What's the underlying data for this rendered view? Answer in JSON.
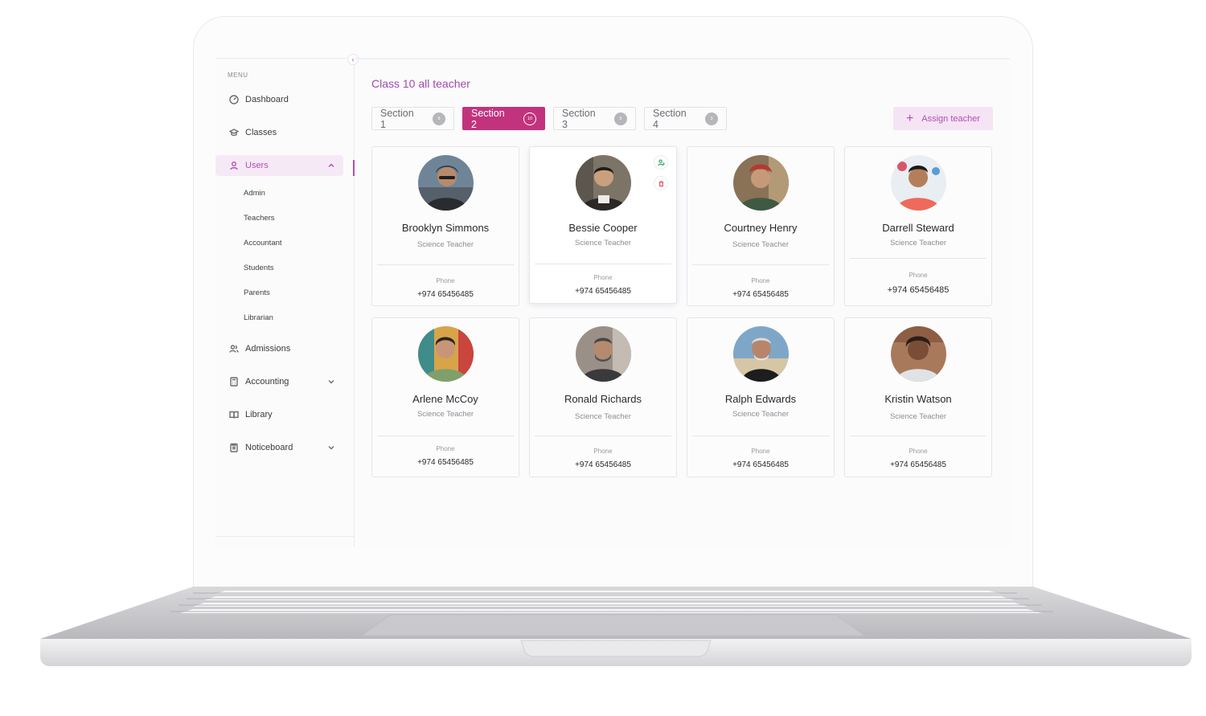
{
  "sidebar": {
    "menu_label": "MENU",
    "items": [
      {
        "label": "Dashboard",
        "icon": "dashboard-icon"
      },
      {
        "label": "Classes",
        "icon": "graduation-cap-icon"
      },
      {
        "label": "Users",
        "icon": "user-icon",
        "expanded": true
      },
      {
        "label": "Admissions",
        "icon": "users-icon"
      },
      {
        "label": "Accounting",
        "icon": "calculator-icon"
      },
      {
        "label": "Library",
        "icon": "book-icon"
      },
      {
        "label": "Noticeboard",
        "icon": "clipboard-icon"
      }
    ],
    "sub_items": [
      "Admin",
      "Teachers",
      "Accountant",
      "Students",
      "Parents",
      "Librarian"
    ]
  },
  "main": {
    "title": "Class 10 all teacher",
    "tabs": [
      {
        "label": "Section 1",
        "count": "8"
      },
      {
        "label": "Section 2",
        "count": "10",
        "active": true
      },
      {
        "label": "Section 3",
        "count": "5"
      },
      {
        "label": "Section 4",
        "count": "3"
      }
    ],
    "assign_button": "Assign teacher",
    "phone_label": "Phone",
    "teachers": [
      {
        "name": "Brooklyn Simmons",
        "role": "Science Teacher",
        "phone": "+974 65456485"
      },
      {
        "name": "Bessie Cooper",
        "role": "Science Teacher",
        "phone": "+974 65456485"
      },
      {
        "name": "Courtney Henry",
        "role": "Science Teacher",
        "phone": "+974 65456485"
      },
      {
        "name": "Darrell Steward",
        "role": "Science Teacher",
        "phone": "+974 65456485"
      },
      {
        "name": "Arlene McCoy",
        "role": "Science Teacher",
        "phone": "+974 65456485"
      },
      {
        "name": "Ronald Richards",
        "role": "Science Teacher",
        "phone": "+974 65456485"
      },
      {
        "name": "Ralph Edwards",
        "role": "Science Teacher",
        "phone": "+974 65456485"
      },
      {
        "name": "Kristin Watson",
        "role": "Science Teacher",
        "phone": "+974 65456485"
      }
    ]
  },
  "colors": {
    "accent": "#b04fb4",
    "active_tab": "#c2337e",
    "assign_bg": "#f5e4f4"
  }
}
